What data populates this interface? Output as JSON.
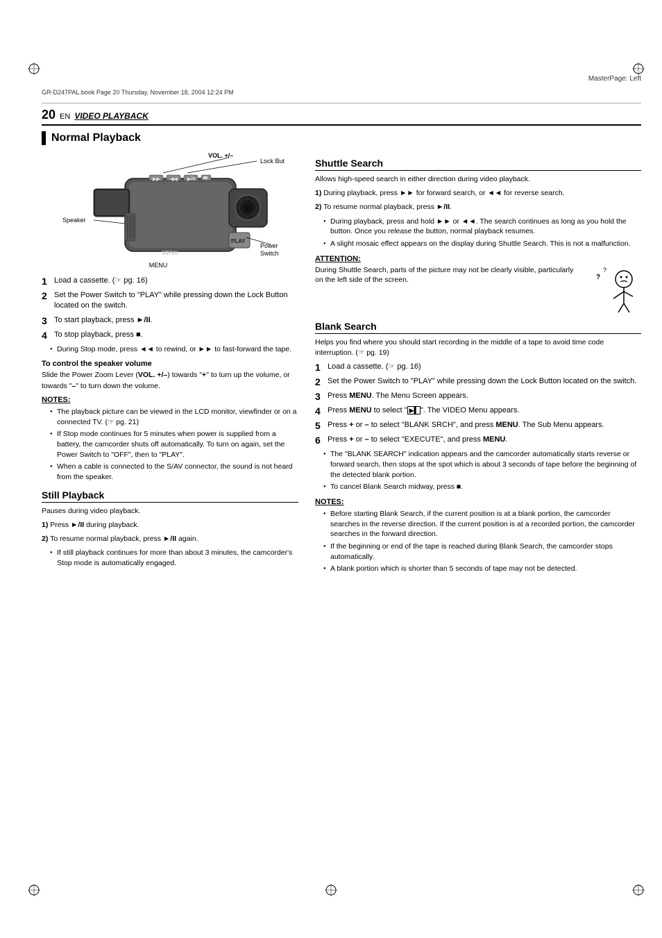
{
  "masterPage": {
    "label": "MasterPage: Left"
  },
  "fileInfo": {
    "text": "GR-D247PAL.book  Page 20  Thursday, November 18, 2004  12:24 PM"
  },
  "page": {
    "number": "20",
    "enLabel": "EN",
    "sectionTitle": "VIDEO PLAYBACK",
    "mainTitle": "Normal Playback"
  },
  "diagram": {
    "labels": {
      "vol": "VOL. +/–",
      "lockButton": "Lock Button",
      "speaker": "Speaker",
      "powerSwitch": "Power Switch",
      "menu": "MENU"
    }
  },
  "normalPlayback": {
    "steps": [
      {
        "number": "1",
        "text": "Load a cassette. (☞ pg. 16)"
      },
      {
        "number": "2",
        "text": "Set the Power Switch to \"PLAY\" while pressing down the Lock Button located on the switch."
      },
      {
        "number": "3",
        "text": "To start playback, press ►/II."
      },
      {
        "number": "4",
        "text": "To stop playback, press ■."
      }
    ],
    "stopModeBullet": "During Stop mode, press ◄◄ to rewind, or ►► to fast-forward the tape.",
    "speakerVolumeTitle": "To control the speaker volume",
    "speakerVolumeText": "Slide the Power Zoom Lever (VOL. +/–) towards \"+\" to turn up the volume, or towards \"–\" to turn down the volume.",
    "notesTitle": "NOTES:",
    "notes": [
      "The playback picture can be viewed in the LCD monitor, viewfinder or on a connected TV. (☞ pg. 21)",
      "If Stop mode continues for 5 minutes when power is supplied from a battery, the camcorder shuts off automatically. To turn on again, set the Power Switch to \"OFF\", then to \"PLAY\".",
      "When a cable is connected to the S/AV connector, the sound is not heard from the speaker."
    ]
  },
  "stillPlayback": {
    "title": "Still Playback",
    "description": "Pauses during video playback.",
    "steps": [
      {
        "number": "1)",
        "text": "Press ►/II during playback."
      },
      {
        "number": "2)",
        "text": "To resume normal playback, press ►/II again."
      }
    ],
    "bullet": "If still playback continues for more than about 3 minutes, the camcorder's Stop mode is automatically engaged."
  },
  "shuttleSearch": {
    "title": "Shuttle Search",
    "description": "Allows high-speed search in either direction during video playback.",
    "steps": [
      {
        "number": "1)",
        "text": "During playback, press ►► for forward search, or ◄◄ for reverse search."
      },
      {
        "number": "2)",
        "text": "To resume normal playback, press ►/II."
      }
    ],
    "bullets": [
      "During playback, press and hold ►► or ◄◄. The search continues as long as you hold the button. Once you release the button, normal playback resumes.",
      "A slight mosaic effect appears on the display during Shuttle Search. This is not a malfunction."
    ],
    "attentionTitle": "ATTENTION:",
    "attentionText": "During Shuttle Search, parts of the picture may not be clearly visible, particularly on the left side of the screen."
  },
  "blankSearch": {
    "title": "Blank Search",
    "description": "Helps you find where you should start recording in the middle of a tape to avoid time code interruption. (☞ pg. 19)",
    "steps": [
      {
        "number": "1",
        "text": "Load a cassette. (☞ pg. 16)"
      },
      {
        "number": "2",
        "text": "Set the Power Switch to \"PLAY\" while pressing down the Lock Button located on the switch."
      },
      {
        "number": "3",
        "text": "Press MENU. The Menu Screen appears."
      },
      {
        "number": "4",
        "text": "Press MENU to select \"  \". The VIDEO Menu appears."
      },
      {
        "number": "5",
        "text": "Press + or – to select \"BLANK SRCH\", and press MENU. The Sub Menu appears."
      },
      {
        "number": "6",
        "text": "Press + or – to select \"EXECUTE\", and press MENU."
      }
    ],
    "bullets": [
      "The \"BLANK SEARCH\" indication appears and the camcorder automatically starts reverse or forward search, then stops at the spot which is about 3 seconds of tape before the beginning of the detected blank portion.",
      "To cancel Blank Search midway, press ■."
    ],
    "notesTitle": "NOTES:",
    "notes": [
      "Before starting Blank Search, if the current position is at a blank portion, the camcorder searches in the reverse direction. If the current position is at a recorded portion, the camcorder searches in the forward direction.",
      "If the beginning or end of the tape is reached during Blank Search, the camcorder stops automatically.",
      "A blank portion which is shorter than 5 seconds of tape may not be detected."
    ]
  }
}
